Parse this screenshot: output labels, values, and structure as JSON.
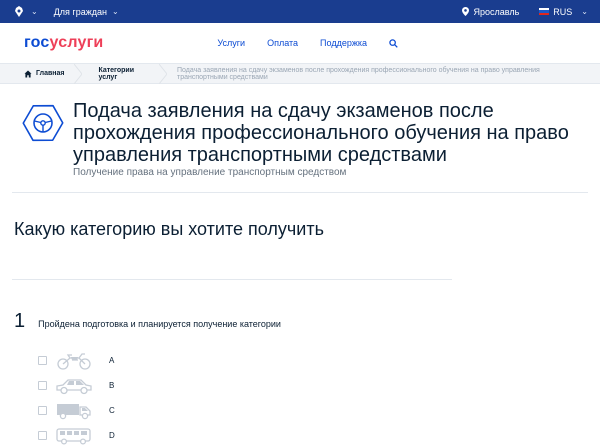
{
  "topbar": {
    "for_citizens": "Для граждан",
    "location": "Ярославль",
    "language": "RUS"
  },
  "header": {
    "logo_part1": "гос",
    "logo_part2": "услуги",
    "nav": [
      "Услуги",
      "Оплата",
      "Поддержка"
    ]
  },
  "breadcrumb": {
    "home": "Главная",
    "category": "Категории услуг",
    "current": "Подача заявления на сдачу экзаменов после прохождения профессионального обучения на право управления транспортными средствами"
  },
  "service": {
    "title": "Подача заявления на сдачу экзаменов после прохождения профессионального обучения на право управления транспортными средствами",
    "subtitle": "Получение права на управление транспортным средством"
  },
  "question": "Какую категорию вы хотите получить",
  "step": {
    "number": "1",
    "text": "Пройдена подготовка и планируется получение категории"
  },
  "options": [
    {
      "label": "A",
      "icon": "motorcycle-icon",
      "checked": false
    },
    {
      "label": "B",
      "icon": "car-icon",
      "checked": false
    },
    {
      "label": "C",
      "icon": "truck-icon",
      "checked": false
    },
    {
      "label": "D",
      "icon": "bus-icon",
      "checked": false
    }
  ],
  "colors": {
    "topbar": "#1a3d8f",
    "brand_blue": "#0d4cd3",
    "brand_red": "#ee3f58"
  }
}
